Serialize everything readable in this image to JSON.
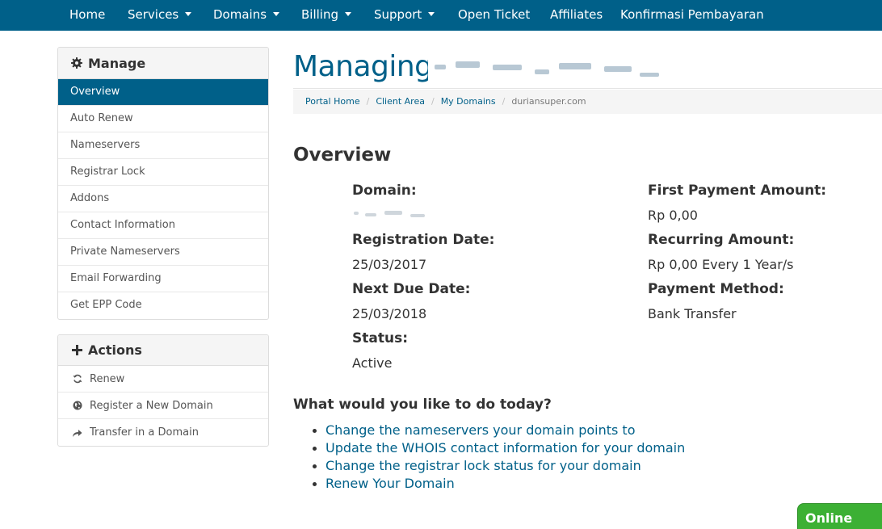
{
  "nav": {
    "home": "Home",
    "services": "Services",
    "domains": "Domains",
    "billing": "Billing",
    "support": "Support",
    "open_ticket": "Open Ticket",
    "affiliates": "Affiliates",
    "konfirmasi": "Konfirmasi Pembayaran"
  },
  "sidebar": {
    "manage": {
      "title": "Manage",
      "icon": "gear-icon",
      "items": [
        {
          "label": "Overview",
          "active": true
        },
        {
          "label": "Auto Renew"
        },
        {
          "label": "Nameservers"
        },
        {
          "label": "Registrar Lock"
        },
        {
          "label": "Addons"
        },
        {
          "label": "Contact Information"
        },
        {
          "label": "Private Nameservers"
        },
        {
          "label": "Email Forwarding"
        },
        {
          "label": "Get EPP Code"
        }
      ]
    },
    "actions": {
      "title": "Actions",
      "icon": "plus-icon",
      "items": [
        {
          "label": "Renew",
          "icon": "refresh-icon"
        },
        {
          "label": "Register a New Domain",
          "icon": "globe-icon"
        },
        {
          "label": "Transfer in a Domain",
          "icon": "share-arrow-icon"
        }
      ]
    }
  },
  "main": {
    "title": "Managing",
    "breadcrumb": [
      "Portal Home",
      "Client Area",
      "My Domains",
      "duriansuper.com"
    ],
    "overview_heading": "Overview",
    "fields": {
      "domain": {
        "label": "Domain:"
      },
      "registration_date": {
        "label": "Registration Date:",
        "value": "25/03/2017"
      },
      "next_due_date": {
        "label": "Next Due Date:",
        "value": "25/03/2018"
      },
      "status": {
        "label": "Status:",
        "value": "Active"
      },
      "first_payment": {
        "label": "First Payment Amount:",
        "value": "Rp 0,00"
      },
      "recurring": {
        "label": "Recurring Amount:",
        "value": "Rp 0,00 Every 1 Year/s"
      },
      "payment_method": {
        "label": "Payment Method:",
        "value": "Bank Transfer"
      }
    },
    "todo": {
      "heading": "What would you like to do today?",
      "links": [
        "Change the nameservers your domain points to",
        "Update the WHOIS contact information for your domain",
        "Change the registrar lock status for your domain",
        "Renew Your Domain"
      ]
    }
  },
  "chat_badge": "Online",
  "colors": {
    "brand": "#006089",
    "online": "#3cb034"
  }
}
